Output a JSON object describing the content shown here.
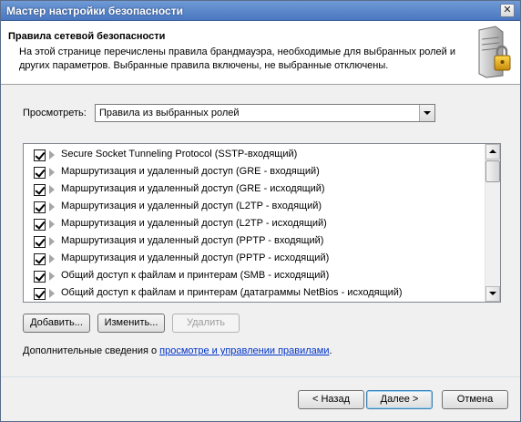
{
  "window": {
    "title": "Мастер настройки безопасности",
    "close_glyph": "✕"
  },
  "header": {
    "title": "Правила сетевой безопасности",
    "description": "На этой странице перечислены правила брандмауэра, необходимые для выбранных ролей и других параметров. Выбранные правила включены, не выбранные отключены.",
    "icon": "server-lock-icon"
  },
  "view": {
    "label": "Просмотреть:",
    "selected": "Правила из выбранных ролей"
  },
  "rules": [
    {
      "label": "Secure Socket Tunneling Protocol (SSTP-входящий)",
      "checked": true
    },
    {
      "label": "Маршрутизация и удаленный доступ (GRE - входящий)",
      "checked": true
    },
    {
      "label": "Маршрутизация и удаленный доступ (GRE - исходящий)",
      "checked": true
    },
    {
      "label": "Маршрутизация и удаленный доступ (L2TP - входящий)",
      "checked": true
    },
    {
      "label": "Маршрутизация и удаленный доступ (L2TP - исходящий)",
      "checked": true
    },
    {
      "label": "Маршрутизация и удаленный доступ (PPTP - входящий)",
      "checked": true
    },
    {
      "label": "Маршрутизация и удаленный доступ (PPTP - исходящий)",
      "checked": true
    },
    {
      "label": "Общий доступ к файлам и принтерам (SMB - исходящий)",
      "checked": true
    },
    {
      "label": "Общий доступ к файлам и принтерам (датаграммы NetBios - исходящий)",
      "checked": true
    }
  ],
  "actions": {
    "add": "Добавить...",
    "edit": "Изменить...",
    "delete": "Удалить"
  },
  "more": {
    "prefix": "Дополнительные сведения о ",
    "link": "просмотре и управлении правилами",
    "suffix": "."
  },
  "nav": {
    "back": "< Назад",
    "next": "Далее >",
    "cancel": "Отмена"
  }
}
